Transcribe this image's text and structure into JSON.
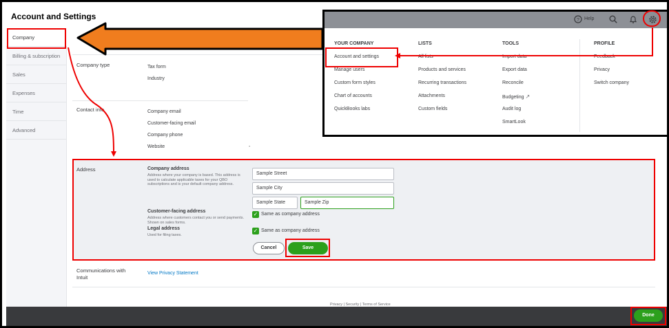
{
  "page": {
    "title": "Account and Settings"
  },
  "sidebar": {
    "items": [
      {
        "label": "Company"
      },
      {
        "label": "Billing & subscription"
      },
      {
        "label": "Sales"
      },
      {
        "label": "Expenses"
      },
      {
        "label": "Time"
      },
      {
        "label": "Advanced"
      }
    ]
  },
  "company_type": {
    "section_label": "Company type",
    "fields": [
      "Tax form",
      "Industry"
    ]
  },
  "contact_info": {
    "section_label": "Contact info",
    "fields": [
      "Company email",
      "Customer-facing email",
      "Company phone",
      "Website"
    ],
    "website_value": "-"
  },
  "address": {
    "section_label": "Address",
    "company_address_title": "Company address",
    "company_address_desc": "Address where your company is based. This address is used to calculate applicable taxes for your QBO subscriptions and is your default company address.",
    "customer_facing_title": "Customer-facing address",
    "customer_facing_desc": "Address where customers contact you or send payments. Shown on sales forms.",
    "legal_title": "Legal address",
    "legal_desc": "Used for filing taxes.",
    "street_value": "Sample Street",
    "city_value": "Sample City",
    "state_value": "Sample State",
    "zip_value": "Sample Zip",
    "same_as_1": "Same as company address",
    "same_as_2": "Same as company address",
    "cancel_label": "Cancel",
    "save_label": "Save"
  },
  "communications": {
    "section_label": "Communications with Intuit",
    "link": "View Privacy Statement"
  },
  "footer": {
    "links": "Privacy  |  Security  |  Terms of Service"
  },
  "bottom_bar": {
    "done_label": "Done"
  },
  "gear_menu": {
    "help_label": "Help",
    "columns": [
      {
        "heading": "YOUR COMPANY",
        "items": [
          "Account and settings",
          "Manage users",
          "Custom form styles",
          "Chart of accounts",
          "QuickBooks labs"
        ]
      },
      {
        "heading": "LISTS",
        "items": [
          "All lists",
          "Products and services",
          "Recurring transactions",
          "Attachments",
          "Custom fields"
        ]
      },
      {
        "heading": "TOOLS",
        "items": [
          "Import data",
          "Export data",
          "Reconcile",
          "Budgeting",
          "Audit log",
          "SmartLook"
        ]
      },
      {
        "heading": "PROFILE",
        "items": [
          "Feedback",
          "Privacy",
          "Switch company"
        ]
      }
    ]
  },
  "colors": {
    "accent_green": "#2ca01c",
    "annotation_red": "#e00000",
    "arrow_orange": "#f07d1e"
  },
  "icons": [
    "help-icon",
    "search-icon",
    "bell-icon",
    "gear-icon",
    "checkmark-icon",
    "rocket-icon"
  ]
}
